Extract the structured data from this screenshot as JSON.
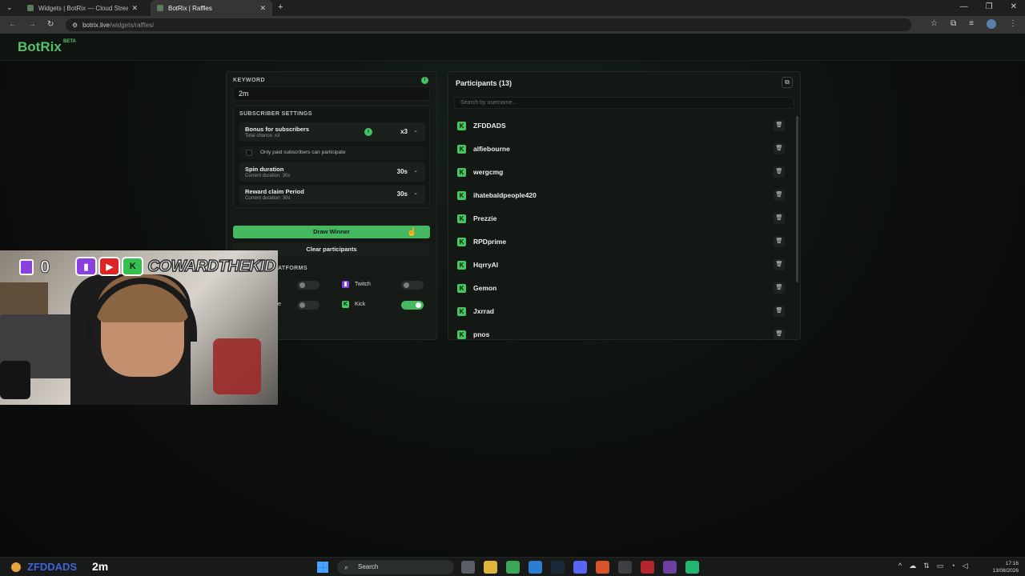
{
  "browser": {
    "tabs": [
      {
        "title": "Widgets | BotRix — Cloud Strea",
        "active": false
      },
      {
        "title": "BotRix | Raffles",
        "active": true
      }
    ],
    "url_site": "botrix.live",
    "url_path": "/widgets/raffles/"
  },
  "header": {
    "logo": "BotRix",
    "badge": "BETA"
  },
  "keyword": {
    "label": "KEYWORD",
    "value": "2m",
    "info": "i"
  },
  "subscriber_settings": {
    "title": "SUBSCRIBER SETTINGS",
    "bonus": {
      "label": "Bonus for subscribers",
      "sub": "Total chance: x3",
      "value": "x3"
    },
    "paid_only_label": "Only paid subscribers can participate",
    "spin": {
      "label": "Spin duration",
      "sub": "Current duration: 30s",
      "value": "30s"
    },
    "reward": {
      "label": "Reward claim Period",
      "sub": "Current duration: 30s",
      "value": "30s"
    }
  },
  "buttons": {
    "draw": "Draw Winner",
    "clear": "Clear participants"
  },
  "platforms": {
    "title_visible": "ATFORMS",
    "twitch": {
      "name": "Twitch",
      "enabled": false
    },
    "youtube": {
      "name_visible": "e",
      "enabled": false
    },
    "kick": {
      "name": "Kick",
      "enabled": true
    },
    "left_top_enabled": false
  },
  "participants": {
    "title": "Participants (13)",
    "search_placeholder": "Search by username...",
    "items": [
      "ZFDDADS",
      "alfiebourne",
      "wergcmg",
      "ihatebaldpeople420",
      "Prezzie",
      "RPDprime",
      "HqrryAI",
      "Gemon",
      "Jxrrad",
      "pnos"
    ]
  },
  "overlay": {
    "viewer_count": "0",
    "streamer_name": "COWARDTHEKID"
  },
  "taskbar": {
    "chat_user": "ZFDDADS",
    "chat_message": "2m",
    "search_label": "Search",
    "time": "17:16",
    "date": "13/08/2026"
  },
  "colors": {
    "accent": "#46b860",
    "kick": "#46c75f",
    "twitch": "#8a3fe0",
    "youtube": "#e02424"
  }
}
